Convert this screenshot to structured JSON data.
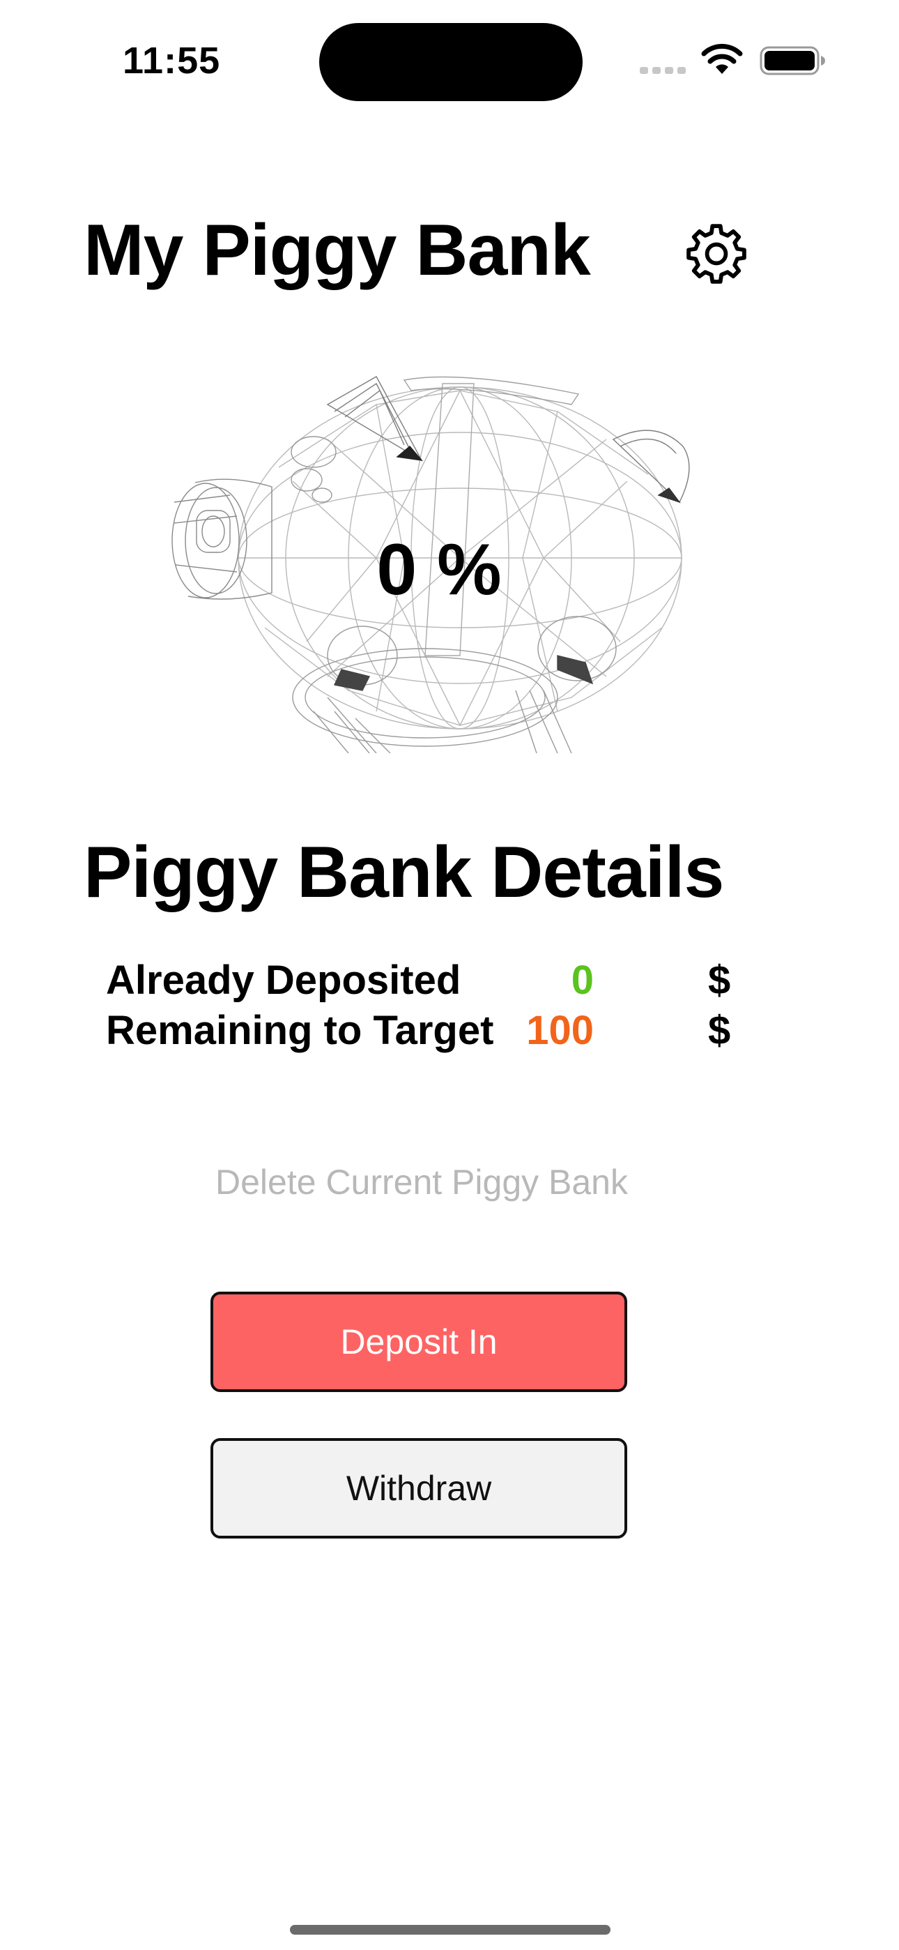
{
  "status_bar": {
    "time": "11:55",
    "icons": [
      "cellular-signal-icon",
      "wifi-icon",
      "battery-icon"
    ]
  },
  "header": {
    "title": "My Piggy Bank",
    "settings_icon": "gear-icon"
  },
  "piggy": {
    "progress_text": "0 %",
    "progress_fraction": 0
  },
  "details": {
    "title": "Piggy Bank Details",
    "rows": [
      {
        "label": "Already Deposited",
        "value": "0",
        "currency": "$",
        "color": "#5ac31e"
      },
      {
        "label": "Remaining to Target",
        "value": "100",
        "currency": "$",
        "color": "#f26419"
      }
    ]
  },
  "actions": {
    "delete_label": "Delete Current Piggy Bank",
    "deposit_label": "Deposit In",
    "withdraw_label": "Withdraw"
  },
  "colors": {
    "deposit_button": "#fe6363",
    "withdraw_button": "#f2f2f2",
    "delete_text": "#b8b8b8",
    "deposited_value": "#5ac31e",
    "remaining_value": "#f26419"
  }
}
